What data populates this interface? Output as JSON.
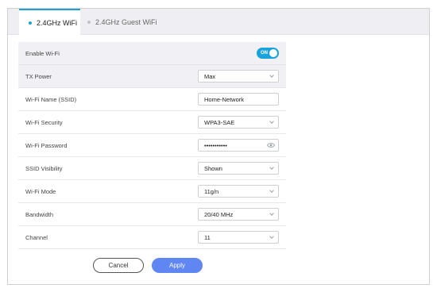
{
  "tabs": [
    {
      "label": "2.4GHz WiFi",
      "active": true
    },
    {
      "label": "2.4GHz Guest WiFi",
      "active": false
    }
  ],
  "settings": {
    "enable_wifi": {
      "label": "Enable Wi-Fi",
      "value": "ON"
    },
    "tx_power": {
      "label": "TX Power",
      "value": "Max"
    },
    "ssid": {
      "label": "Wi-Fi Name (SSID)",
      "value": "Home-Network"
    },
    "security": {
      "label": "Wi-Fi Security",
      "value": "WPA3-SAE"
    },
    "password": {
      "label": "Wi-Fi Password",
      "value": "•••••••••••"
    },
    "ssid_visibility": {
      "label": "SSID Visibility",
      "value": "Shown"
    },
    "mode": {
      "label": "Wi-Fi Mode",
      "value": "11g/n"
    },
    "bandwidth": {
      "label": "Bandwidth",
      "value": "20/40 MHz"
    },
    "channel": {
      "label": "Channel",
      "value": "11"
    }
  },
  "actions": {
    "cancel": "Cancel",
    "apply": "Apply"
  },
  "colors": {
    "accent": "#1aa3d8",
    "apply_button": "#5f86f2",
    "shaded_row": "#f1f1f5"
  }
}
